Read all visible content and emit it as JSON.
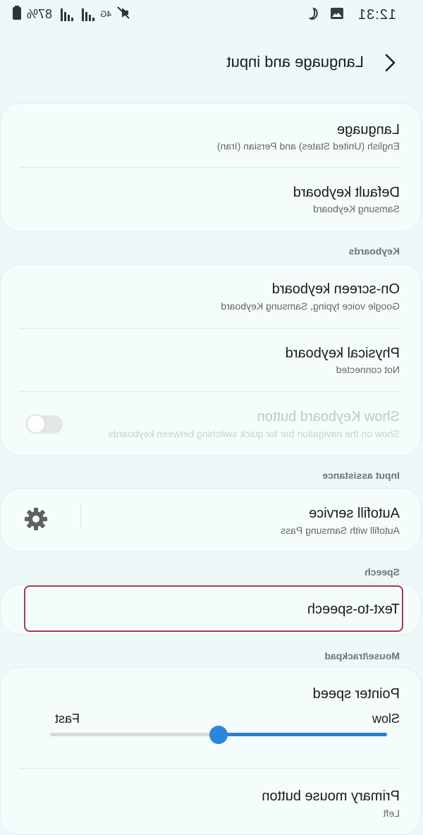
{
  "status_bar": {
    "time": "12:31",
    "battery": "87%",
    "network": "4G",
    "icons": [
      "image-icon",
      "moon-icon",
      "mute-icon",
      "battery-icon"
    ]
  },
  "header": {
    "title": "Language and input"
  },
  "general": {
    "language_title": "Language",
    "language_value": "English (United States) and Persian (Iran)",
    "default_keyboard_title": "Default keyboard",
    "default_keyboard_value": "Samsung Keyboard"
  },
  "keyboards": {
    "section_label": "Keyboards",
    "on_screen_title": "On-screen keyboard",
    "on_screen_value": "Google voice typing, Samsung Keyboard",
    "physical_title": "Physical keyboard",
    "physical_value": "Not connected",
    "show_button_title": "Show Keyboard button",
    "show_button_desc": "Show on the navigation bar for quick switching between keyboards",
    "show_button_on": false
  },
  "input_assistance": {
    "section_label": "Input assistance",
    "autofill_title": "Autofill service",
    "autofill_value": "Autofill with Samsung Pass"
  },
  "speech": {
    "section_label": "Speech",
    "tts_title": "Text-to-speech"
  },
  "mouse": {
    "section_label": "Mouse/trackpad",
    "pointer_title": "Pointer speed",
    "slow_label": "Slow",
    "fast_label": "Fast",
    "pointer_speed_fraction": 0.5,
    "primary_title": "Primary mouse button",
    "primary_value": "Left"
  },
  "colors": {
    "accent": "#2a87dc",
    "highlight_border": "#a83a4d",
    "background": "#edf9f9"
  }
}
